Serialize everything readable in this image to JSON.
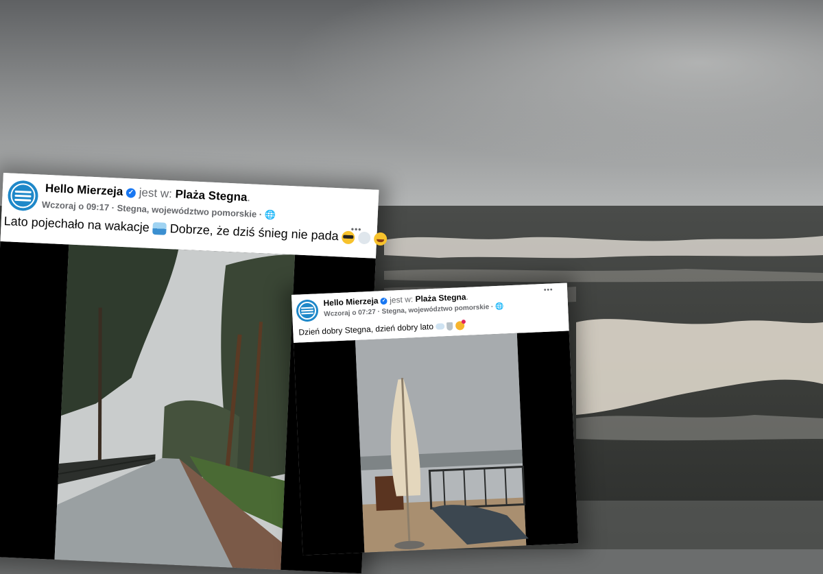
{
  "colors": {
    "brand_blue": "#1e88c9",
    "verified_blue": "#1877f2",
    "text_primary": "#050505",
    "text_secondary": "#65676b"
  },
  "post1": {
    "page_name": "Hello Mierzeja",
    "checkin_prefix": "jest w:",
    "place": "Plaża Stegna",
    "timestamp": "Wczoraj o 09:17",
    "location": "Stegna, województwo pomorskie",
    "privacy_icon": "globe-icon",
    "more_label": "•••",
    "text_part1": "Lato pojechało na wakacje",
    "text_part2": "Dobrze, że dziś śnieg nie pada",
    "emojis": [
      "sea-emoji",
      "sunglasses-emoji",
      "snowflake-emoji",
      "grinning-emoji"
    ],
    "media": "rainy promenade with pine trees"
  },
  "post2": {
    "page_name": "Hello Mierzeja",
    "checkin_prefix": "jest w:",
    "place": "Plaża Stegna",
    "timestamp": "Wczoraj o 07:27",
    "location": "Stegna, województwo pomorskie",
    "privacy_icon": "globe-icon",
    "more_label": "•••",
    "text": "Dzień dobry Stegna, dzień dobry lato",
    "emojis": [
      "cloud-emoji",
      "tornado-emoji",
      "heart-face-emoji"
    ],
    "media": "closed beach umbrella on terrace, stormy sea"
  }
}
